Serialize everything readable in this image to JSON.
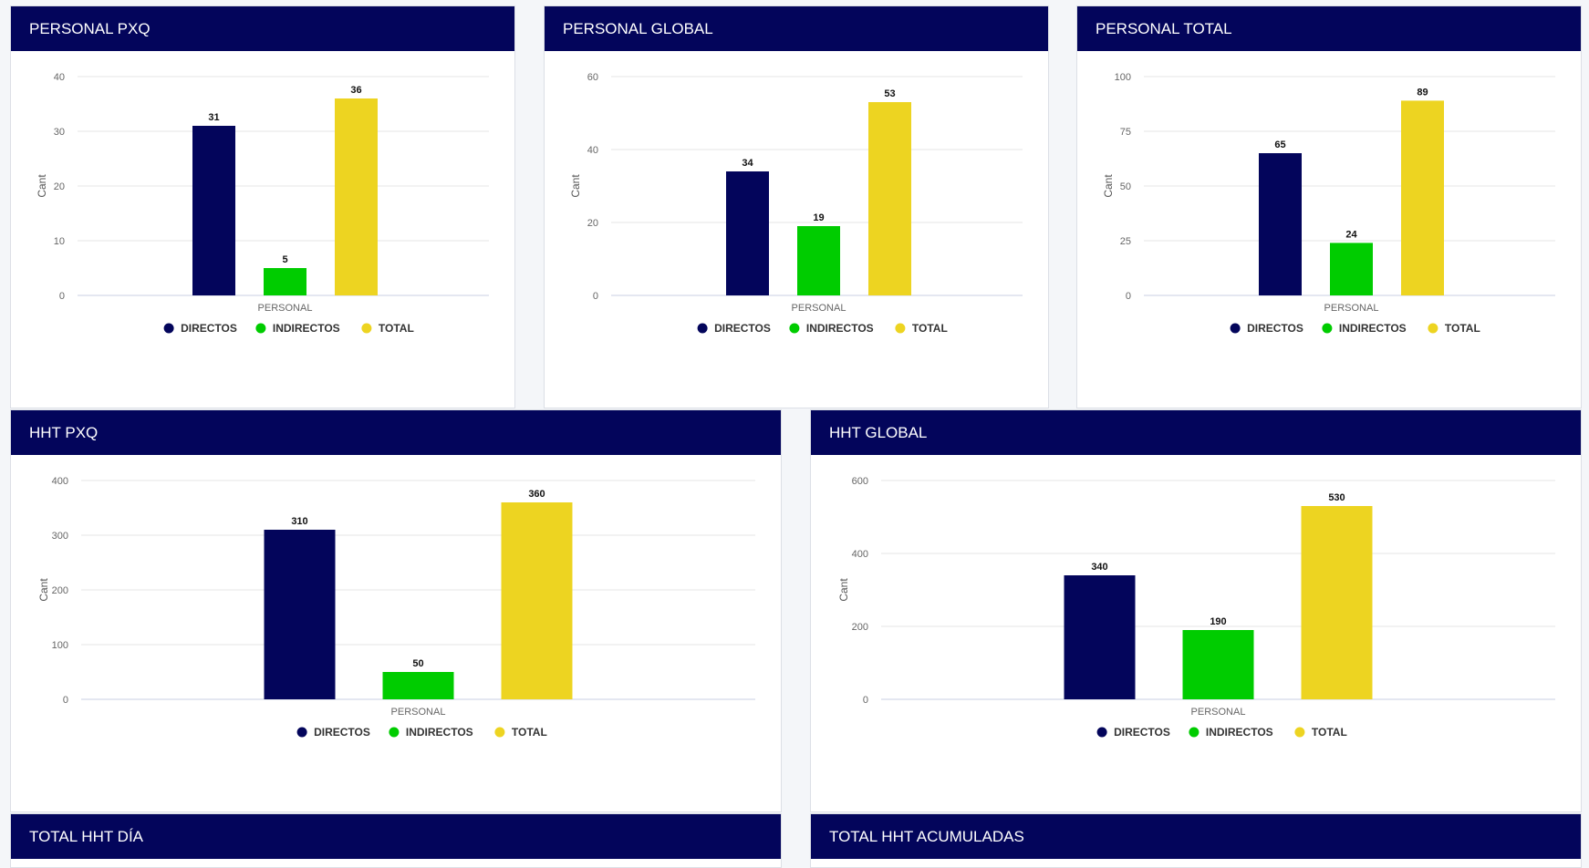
{
  "colors": {
    "header_bg": "#03055b",
    "directos": "#03055b",
    "indirectos": "#00cc00",
    "total": "#edd421"
  },
  "panels": [
    {
      "title": "PERSONAL PXQ"
    },
    {
      "title": "PERSONAL GLOBAL"
    },
    {
      "title": "PERSONAL TOTAL"
    },
    {
      "title": "HHT PXQ"
    },
    {
      "title": "HHT GLOBAL"
    },
    {
      "title": "TOTAL HHT DÍA"
    },
    {
      "title": "TOTAL HHT ACUMULADAS"
    }
  ],
  "chart_data": [
    {
      "type": "bar",
      "title": "PERSONAL PXQ",
      "ylabel": "Cant",
      "categories": [
        "PERSONAL"
      ],
      "ylim": [
        0,
        40
      ],
      "yticks": [
        0,
        10,
        20,
        30,
        40
      ],
      "series": [
        {
          "name": "DIRECTOS",
          "values": [
            31
          ]
        },
        {
          "name": "INDIRECTOS",
          "values": [
            5
          ]
        },
        {
          "name": "TOTAL",
          "values": [
            36
          ]
        }
      ],
      "legend": "bottom",
      "grid": true
    },
    {
      "type": "bar",
      "title": "PERSONAL GLOBAL",
      "ylabel": "Cant",
      "categories": [
        "PERSONAL"
      ],
      "ylim": [
        0,
        60
      ],
      "yticks": [
        0,
        20,
        40,
        60
      ],
      "series": [
        {
          "name": "DIRECTOS",
          "values": [
            34
          ]
        },
        {
          "name": "INDIRECTOS",
          "values": [
            19
          ]
        },
        {
          "name": "TOTAL",
          "values": [
            53
          ]
        }
      ],
      "legend": "bottom",
      "grid": true
    },
    {
      "type": "bar",
      "title": "PERSONAL TOTAL",
      "ylabel": "Cant",
      "categories": [
        "PERSONAL"
      ],
      "ylim": [
        0,
        100
      ],
      "yticks": [
        0,
        25,
        50,
        75,
        100
      ],
      "series": [
        {
          "name": "DIRECTOS",
          "values": [
            65
          ]
        },
        {
          "name": "INDIRECTOS",
          "values": [
            24
          ]
        },
        {
          "name": "TOTAL",
          "values": [
            89
          ]
        }
      ],
      "legend": "bottom",
      "grid": true
    },
    {
      "type": "bar",
      "title": "HHT PXQ",
      "ylabel": "Cant",
      "categories": [
        "PERSONAL"
      ],
      "ylim": [
        0,
        400
      ],
      "yticks": [
        0,
        100,
        200,
        300,
        400
      ],
      "series": [
        {
          "name": "DIRECTOS",
          "values": [
            310
          ]
        },
        {
          "name": "INDIRECTOS",
          "values": [
            50
          ]
        },
        {
          "name": "TOTAL",
          "values": [
            360
          ]
        }
      ],
      "legend": "bottom",
      "grid": true
    },
    {
      "type": "bar",
      "title": "HHT GLOBAL",
      "ylabel": "Cant",
      "categories": [
        "PERSONAL"
      ],
      "ylim": [
        0,
        600
      ],
      "yticks": [
        0,
        200,
        400,
        600
      ],
      "series": [
        {
          "name": "DIRECTOS",
          "values": [
            340
          ]
        },
        {
          "name": "INDIRECTOS",
          "values": [
            190
          ]
        },
        {
          "name": "TOTAL",
          "values": [
            530
          ]
        }
      ],
      "legend": "bottom",
      "grid": true
    }
  ]
}
